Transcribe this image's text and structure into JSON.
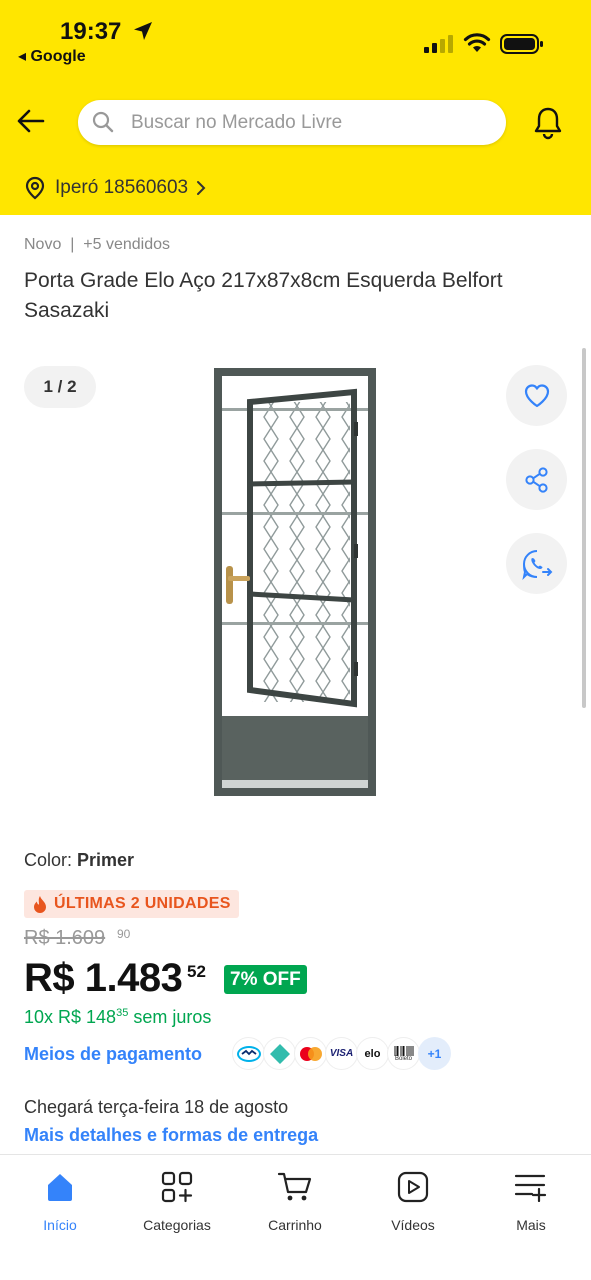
{
  "status_bar": {
    "time": "19:37",
    "back_app": "◂ Google"
  },
  "header": {
    "search_placeholder": "Buscar no Mercado Livre",
    "address": "Iperó 18560603"
  },
  "product": {
    "condition": "Novo  |  +5 vendidos",
    "title": "Porta Grade Elo Aço 217x87x8cm Esquerda Belfort Sasazaki",
    "image_counter": "1 / 2",
    "color_label": "Color: ",
    "color_value": "Primer",
    "stock_badge": "ÚLTIMAS 2 UNIDADES",
    "old_price": "R$ 1.609",
    "old_price_cents": "90",
    "price": "R$ 1.483",
    "price_cents": "52",
    "discount": "7% OFF",
    "installments": "10x R$ 148",
    "installments_cents": "35",
    "installments_suffix": " sem juros",
    "payment_link": "Meios de pagamento",
    "payment_more": "+1",
    "payment_methods": [
      "mercado-pago-icon",
      "pix-icon",
      "mastercard-icon",
      "visa-icon",
      "elo-icon",
      "boleto-icon"
    ],
    "payment_visa": "VISA",
    "payment_elo": "elo",
    "payment_boleto": "Boleto",
    "delivery": "Chegará terça-feira 18 de agosto",
    "delivery_link": "Mais detalhes e formas de entrega"
  },
  "bottom_nav": {
    "items": [
      {
        "label": "Início",
        "icon": "home-icon",
        "active": true
      },
      {
        "label": "Categorias",
        "icon": "categories-icon",
        "active": false
      },
      {
        "label": "Carrinho",
        "icon": "cart-icon",
        "active": false
      },
      {
        "label": "Vídeos",
        "icon": "video-icon",
        "active": false
      },
      {
        "label": "Mais",
        "icon": "menu-plus-icon",
        "active": false
      }
    ]
  },
  "colors": {
    "header_yellow": "#ffe600",
    "link_blue": "#3483fa",
    "green": "#00a650",
    "stock_orange": "#e8551e"
  }
}
